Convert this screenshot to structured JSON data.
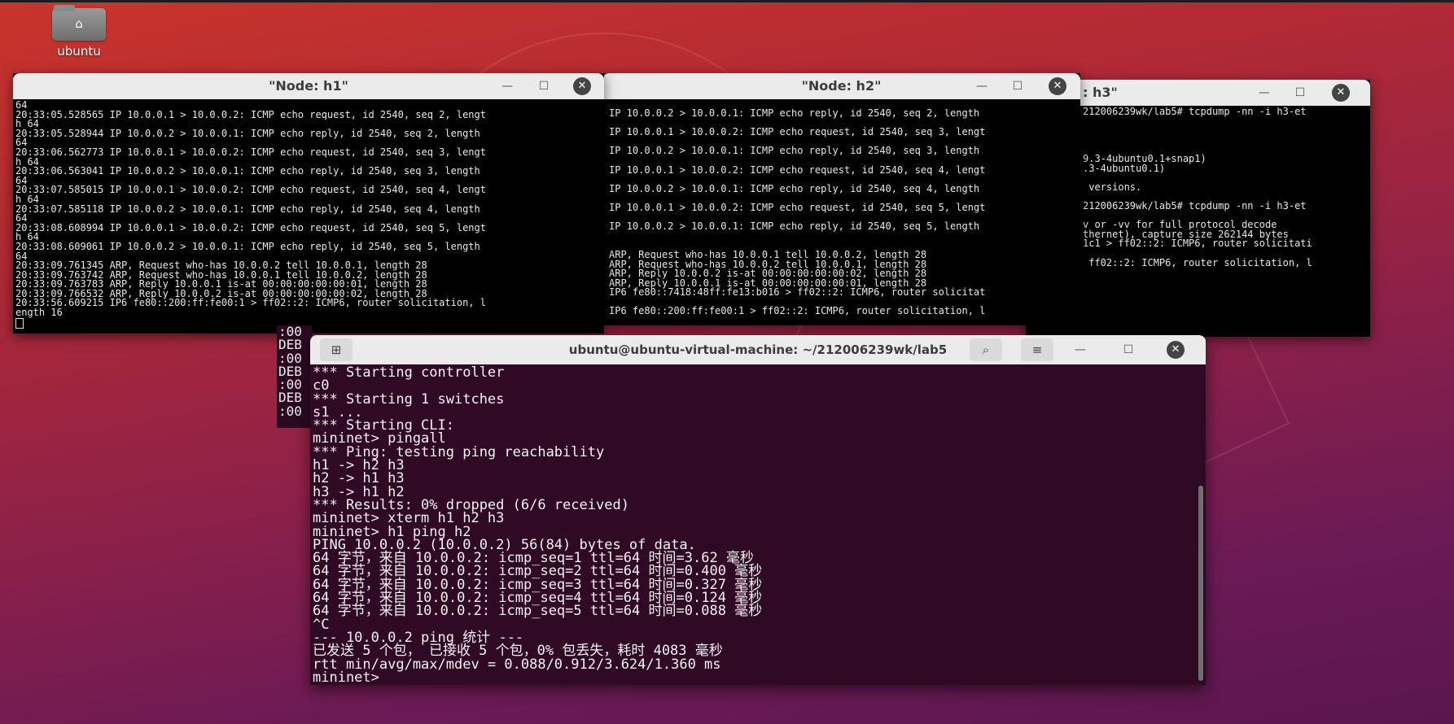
{
  "desktop": {
    "home_folder_label": "ubuntu"
  },
  "h1": {
    "title": "\"Node: h1\"",
    "lines": [
      "64",
      "20:33:05.528565 IP 10.0.0.1 > 10.0.0.2: ICMP echo request, id 2540, seq 2, lengt",
      "h 64",
      "20:33:05.528944 IP 10.0.0.2 > 10.0.0.1: ICMP echo reply, id 2540, seq 2, length",
      "64",
      "20:33:06.562773 IP 10.0.0.1 > 10.0.0.2: ICMP echo request, id 2540, seq 3, lengt",
      "h 64",
      "20:33:06.563041 IP 10.0.0.2 > 10.0.0.1: ICMP echo reply, id 2540, seq 3, length",
      "64",
      "20:33:07.585015 IP 10.0.0.1 > 10.0.0.2: ICMP echo request, id 2540, seq 4, lengt",
      "h 64",
      "20:33:07.585118 IP 10.0.0.2 > 10.0.0.1: ICMP echo reply, id 2540, seq 4, length",
      "64",
      "20:33:08.608994 IP 10.0.0.1 > 10.0.0.2: ICMP echo request, id 2540, seq 5, lengt",
      "h 64",
      "20:33:08.609061 IP 10.0.0.2 > 10.0.0.1: ICMP echo reply, id 2540, seq 5, length",
      "64",
      "20:33:09.761345 ARP, Request who-has 10.0.0.2 tell 10.0.0.1, length 28",
      "20:33:09.763742 ARP, Request who-has 10.0.0.1 tell 10.0.0.2, length 28",
      "20:33:09.763783 ARP, Reply 10.0.0.1 is-at 00:00:00:00:00:01, length 28",
      "20:33:09.766532 ARP, Reply 10.0.0.2 is-at 00:00:00:00:00:02, length 28",
      "20:33:56.609215 IP6 fe80::200:ff:fe00:1 > ff02::2: ICMP6, router solicitation, l",
      "ength 16"
    ]
  },
  "h2": {
    "title": "\"Node: h2\"",
    "lines": [
      "IP 10.0.0.2 > 10.0.0.1: ICMP echo reply, id 2540, seq 2, length",
      "",
      "IP 10.0.0.1 > 10.0.0.2: ICMP echo request, id 2540, seq 3, lengt",
      "",
      "IP 10.0.0.2 > 10.0.0.1: ICMP echo reply, id 2540, seq 3, length",
      "",
      "IP 10.0.0.1 > 10.0.0.2: ICMP echo request, id 2540, seq 4, lengt",
      "",
      "IP 10.0.0.2 > 10.0.0.1: ICMP echo reply, id 2540, seq 4, length",
      "",
      "IP 10.0.0.1 > 10.0.0.2: ICMP echo request, id 2540, seq 5, lengt",
      "",
      "IP 10.0.0.2 > 10.0.0.1: ICMP echo reply, id 2540, seq 5, length",
      "",
      "",
      "ARP, Request who-has 10.0.0.1 tell 10.0.0.2, length 28",
      "ARP, Request who-has 10.0.0.2 tell 10.0.0.1, length 28",
      "ARP, Reply 10.0.0.2 is-at 00:00:00:00:00:02, length 28",
      "ARP, Reply 10.0.0.1 is-at 00:00:00:00:00:01, length 28",
      "IP6 fe80::7418:48ff:fe13:b016 > ff02::2: ICMP6, router solicitat",
      "",
      "IP6 fe80::200:ff:fe00:1 > ff02::2: ICMP6, router solicitation, l"
    ]
  },
  "h3": {
    "title": ": h3\"",
    "lines": [
      "212006239wk/lab5# tcpdump -nn -i h3-et",
      "",
      "",
      "",
      "",
      "9.3-4ubuntu0.1+snap1)",
      ".3-4ubuntu0.1)",
      "",
      " versions.",
      "",
      "212006239wk/lab5# tcpdump -nn -i h3-et",
      "",
      "v or -vv for full protocol decode",
      "thernet), capture size 262144 bytes",
      "1c1 > ff02::2: ICMP6, router solicitati",
      "",
      " ff02::2: ICMP6, router solicitation, l"
    ]
  },
  "deb_fragment": [
    ":00",
    "DEB",
    ":00",
    "DEB",
    ":00",
    "DEB",
    ":00"
  ],
  "gterm": {
    "title": "ubuntu@ubuntu-virtual-machine: ~/212006239wk/lab5",
    "lines": [
      "*** Starting controller",
      "c0",
      "*** Starting 1 switches",
      "s1 ...",
      "*** Starting CLI:",
      "mininet> pingall",
      "*** Ping: testing ping reachability",
      "h1 -> h2 h3",
      "h2 -> h1 h3",
      "h3 -> h1 h2",
      "*** Results: 0% dropped (6/6 received)",
      "mininet> xterm h1 h2 h3",
      "mininet> h1 ping h2",
      "PING 10.0.0.2 (10.0.0.2) 56(84) bytes of data.",
      "64 字节，来自 10.0.0.2: icmp_seq=1 ttl=64 时间=3.62 毫秒",
      "64 字节，来自 10.0.0.2: icmp_seq=2 ttl=64 时间=0.400 毫秒",
      "64 字节，来自 10.0.0.2: icmp_seq=3 ttl=64 时间=0.327 毫秒",
      "64 字节，来自 10.0.0.2: icmp_seq=4 ttl=64 时间=0.124 毫秒",
      "64 字节，来自 10.0.0.2: icmp_seq=5 ttl=64 时间=0.088 毫秒",
      "^C",
      "--- 10.0.0.2 ping 统计 ---",
      "已发送 5 个包， 已接收 5 个包，0% 包丢失，耗时 4083 毫秒",
      "rtt min/avg/max/mdev = 0.088/0.912/3.624/1.360 ms",
      "mininet> "
    ]
  },
  "icons": {
    "minimize": "minimize-icon",
    "maximize": "maximize-icon",
    "close": "close-icon",
    "new_tab": "new-tab-icon",
    "search": "search-icon",
    "menu": "hamburger-menu-icon",
    "home": "home-icon"
  }
}
